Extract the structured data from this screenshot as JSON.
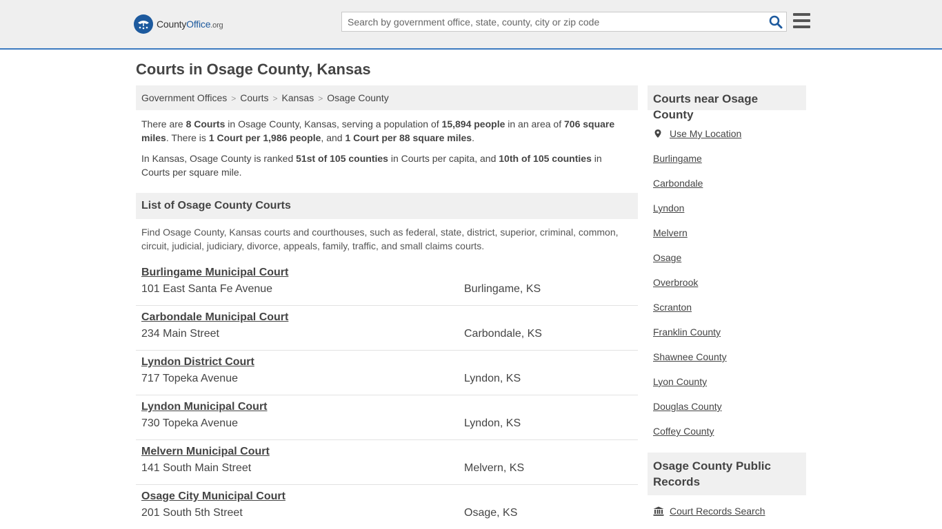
{
  "header": {
    "logo": {
      "brand_a": "County",
      "brand_b": "Office",
      "brand_c": ".org"
    },
    "search": {
      "placeholder": "Search by government office, state, county, city or zip code",
      "value": ""
    },
    "icons": {
      "search": "search-icon",
      "menu": "hamburger-menu-icon",
      "logo": "seal-logo-icon"
    },
    "accent_color": "#3c7ac0"
  },
  "page": {
    "title": "Courts in Osage County, Kansas",
    "breadcrumb": [
      "Government Offices",
      "Courts",
      "Kansas",
      "Osage County"
    ],
    "summary": {
      "p1": {
        "t1": "There are ",
        "b1": "8 Courts",
        "t2": " in Osage County, Kansas, serving a population of ",
        "b2": "15,894 people",
        "t3": " in an area of ",
        "b3": "706 square miles",
        "t4": ". There is ",
        "b4": "1 Court per 1,986 people",
        "t5": ", and ",
        "b5": "1 Court per 88 square miles",
        "t6": "."
      },
      "p2": {
        "t1": "In Kansas, Osage County is ranked ",
        "b1": "51st of 105 counties",
        "t2": " in Courts per capita, and ",
        "b2": "10th of 105 counties",
        "t3": " in Courts per square mile."
      }
    },
    "list_heading": "List of Osage County Courts",
    "list_description": "Find Osage County, Kansas courts and courthouses, such as federal, state, district, superior, criminal, common, circuit, judicial, judiciary, divorce, appeals, family, traffic, and small claims courts.",
    "courts": [
      {
        "name": "Burlingame Municipal Court",
        "address": "101 East Santa Fe Avenue",
        "city": "Burlingame, KS"
      },
      {
        "name": "Carbondale Municipal Court",
        "address": "234 Main Street",
        "city": "Carbondale, KS"
      },
      {
        "name": "Lyndon District Court",
        "address": "717 Topeka Avenue",
        "city": "Lyndon, KS"
      },
      {
        "name": "Lyndon Municipal Court",
        "address": "730 Topeka Avenue",
        "city": "Lyndon, KS"
      },
      {
        "name": "Melvern Municipal Court",
        "address": "141 South Main Street",
        "city": "Melvern, KS"
      },
      {
        "name": "Osage City Municipal Court",
        "address": "201 South 5th Street",
        "city": "Osage, KS"
      }
    ]
  },
  "sidebar": {
    "nearby_heading": "Courts near Osage County",
    "use_location": "Use My Location",
    "nearby": [
      "Burlingame",
      "Carbondale",
      "Lyndon",
      "Melvern",
      "Osage",
      "Overbrook",
      "Scranton",
      "Franklin County",
      "Shawnee County",
      "Lyon County",
      "Douglas County",
      "Coffey County"
    ],
    "records_heading": "Osage County Public Records",
    "records_link": "Court Records Search",
    "icons": {
      "location": "map-pin-icon",
      "records": "courthouse-icon"
    }
  }
}
